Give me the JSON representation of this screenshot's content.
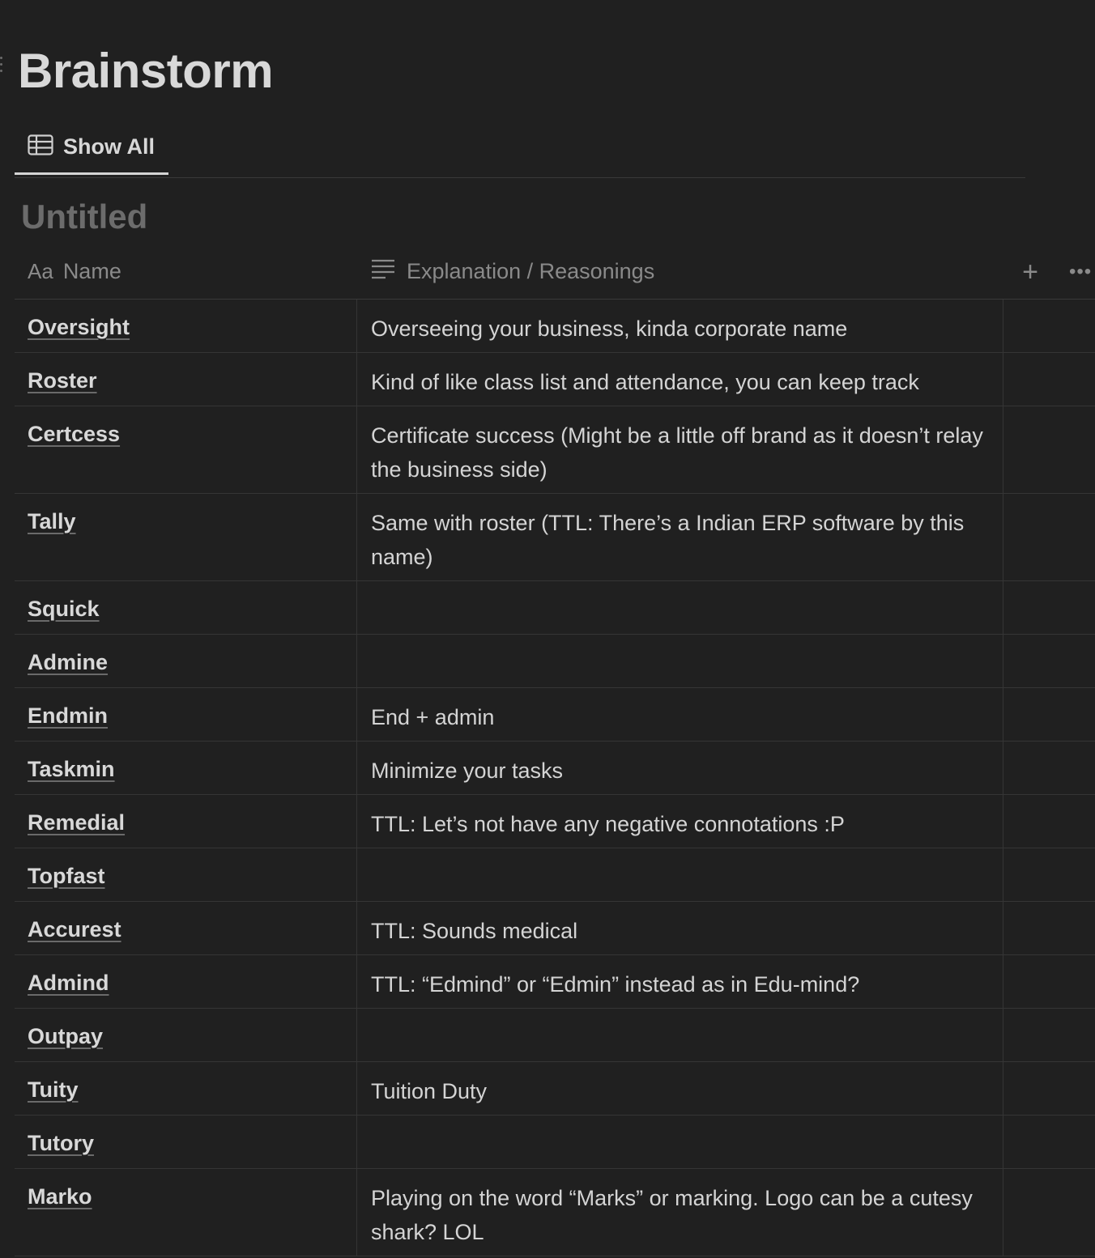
{
  "page": {
    "title": "Brainstorm"
  },
  "tabs": [
    {
      "label": "Show All",
      "icon": "table-icon",
      "active": true
    }
  ],
  "database": {
    "title": "Untitled",
    "columns": [
      {
        "label": "Name",
        "icon": "Aa"
      },
      {
        "label": "Explanation / Reasonings",
        "icon": "text-lines-icon"
      }
    ],
    "add_column_label": "+",
    "more_label": "•••",
    "rows": [
      {
        "name": "Oversight",
        "explanation": "Overseeing your business, kinda corporate name"
      },
      {
        "name": "Roster",
        "explanation": "Kind of like class list and attendance, you can keep track"
      },
      {
        "name": "Certcess",
        "explanation": "Certificate success (Might be a little off brand as it doesn’t relay the business side)"
      },
      {
        "name": "Tally",
        "explanation": "Same with roster (TTL: There’s a Indian ERP software by this name)"
      },
      {
        "name": "Squick",
        "explanation": ""
      },
      {
        "name": "Admine",
        "explanation": ""
      },
      {
        "name": "Endmin",
        "explanation": "End + admin"
      },
      {
        "name": "Taskmin",
        "explanation": "Minimize your tasks"
      },
      {
        "name": "Remedial",
        "explanation": "TTL: Let’s not have any negative connotations :P"
      },
      {
        "name": "Topfast",
        "explanation": ""
      },
      {
        "name": "Accurest",
        "explanation": "TTL: Sounds medical"
      },
      {
        "name": "Admind",
        "explanation": "TTL: “Edmind” or “Edmin” instead as in Edu-mind?"
      },
      {
        "name": "Outpay",
        "explanation": ""
      },
      {
        "name": "Tuity",
        "explanation": "Tuition Duty"
      },
      {
        "name": "Tutory",
        "explanation": ""
      },
      {
        "name": "Marko",
        "explanation": "Playing on the word “Marks” or marking. Logo can be a cutesy shark? LOL"
      }
    ]
  }
}
